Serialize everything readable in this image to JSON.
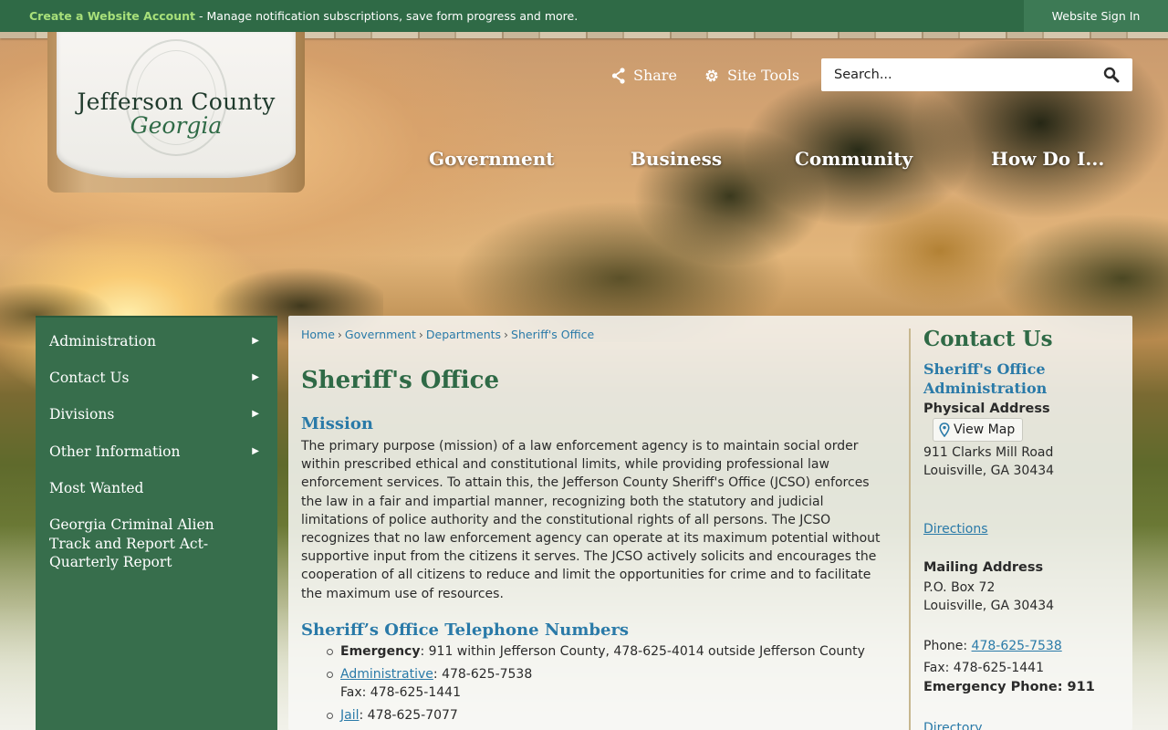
{
  "topbar": {
    "account_link": "Create a Website Account",
    "account_msg": " - Manage notification subscriptions, save form progress and more.",
    "signin": "Website Sign In"
  },
  "logo": {
    "title": "Jefferson County",
    "subtitle": "Georgia"
  },
  "header": {
    "share": "Share",
    "site_tools": "Site Tools",
    "search_placeholder": "Search...",
    "nav": [
      "Government",
      "Business",
      "Community",
      "How Do I..."
    ]
  },
  "sidenav": {
    "items": [
      {
        "label": "Administration",
        "arrow": "▶"
      },
      {
        "label": "Contact Us",
        "arrow": "▶"
      },
      {
        "label": "Divisions",
        "arrow": "▶"
      },
      {
        "label": "Other Information",
        "arrow": "▶"
      },
      {
        "label": "Most Wanted"
      },
      {
        "label": "Georgia Criminal Alien Track and Report Act-Quarterly Report"
      }
    ]
  },
  "breadcrumbs": [
    "Home",
    "Government",
    "Departments",
    "Sheriff's Office"
  ],
  "breadcrumb_sep": "›",
  "page": {
    "title": "Sheriff's Office",
    "mission_heading": "Mission",
    "mission_text": "The primary purpose (mission) of a law enforcement agency is to maintain social order within prescribed ethical and constitutional limits, while providing professional law enforcement services. To attain this, the Jefferson County Sheriff's Office (JCSO) enforces the law in a fair and impartial manner, recognizing both the statutory and judicial limitations of police authority and the constitutional rights of all persons. The JCSO recognizes that no law enforcement agency can operate at its maximum potential without supportive input from the citizens it serves. The JCSO actively solicits and encourages the cooperation of all citizens to reduce and limit the opportunities for crime and to facilitate the maximum use of resources.",
    "phones_heading": "Sheriff’s Office Telephone Numbers",
    "phones": {
      "emergency_label": "Emergency",
      "emergency_text": ": 911 within Jefferson County, 478-625-4014 outside Jefferson County",
      "admin_link": "Administrative",
      "admin_text": ": 478-625-7538",
      "admin_fax": "Fax: 478-625-1441",
      "jail_link": "Jail",
      "jail_text": ": 478-625-7077"
    }
  },
  "contact": {
    "title": "Contact Us",
    "org": "Sheriff's Office Administration",
    "physical_label": "Physical Address",
    "view_map": "View Map",
    "street": "911 Clarks Mill Road",
    "city": "Louisville, GA 30434",
    "directions": "Directions",
    "mailing_label": "Mailing Address",
    "po": "P.O. Box 72",
    "mail_city": "Louisville, GA 30434",
    "phone_label": "Phone: ",
    "phone": "478-625-7538",
    "fax": "Fax: 478-625-1441",
    "emergency": "Emergency Phone: 911",
    "directory": "Directory"
  },
  "colors": {
    "primary_green": "#2f6a46",
    "link_blue": "#2a7aa8",
    "account_green": "#a8e07a"
  }
}
